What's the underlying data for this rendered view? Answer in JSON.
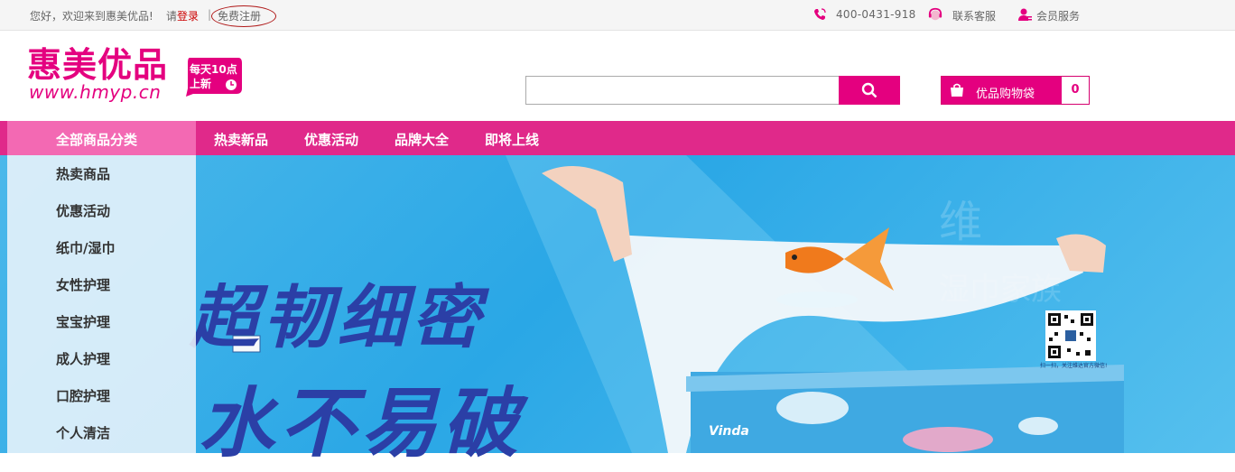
{
  "topbar": {
    "welcome": "您好，欢迎来到惠美优品!",
    "login_prefix": "请",
    "login": "登录",
    "separator": "|",
    "register": "免费注册",
    "phone": "400-0431-918",
    "service": "联系客服",
    "member": "会员服务"
  },
  "logo": {
    "name_cn": "惠美优品",
    "url": "www.hmyp.cn",
    "badge_line1": "每天10点",
    "badge_line2": "上新"
  },
  "search": {
    "placeholder": "",
    "value": ""
  },
  "cart": {
    "label": "优品购物袋",
    "count": "0"
  },
  "nav": {
    "all_categories": "全部商品分类",
    "items": [
      "热卖新品",
      "优惠活动",
      "品牌大全",
      "即将上线"
    ]
  },
  "sidebar": {
    "categories": [
      "热卖商品",
      "优惠活动",
      "纸巾/湿巾",
      "女性护理",
      "宝宝护理",
      "成人护理",
      "口腔护理",
      "个人清洁"
    ]
  },
  "banner": {
    "headline_1": "超韧细密",
    "headline_2": "水不易破",
    "brand": "Vinda",
    "qr_caption": "扫一扫，关注维达官方微信!"
  },
  "colors": {
    "brand": "#e4007f",
    "nav": "#e0298a",
    "nav_highlight": "#f369b3"
  }
}
